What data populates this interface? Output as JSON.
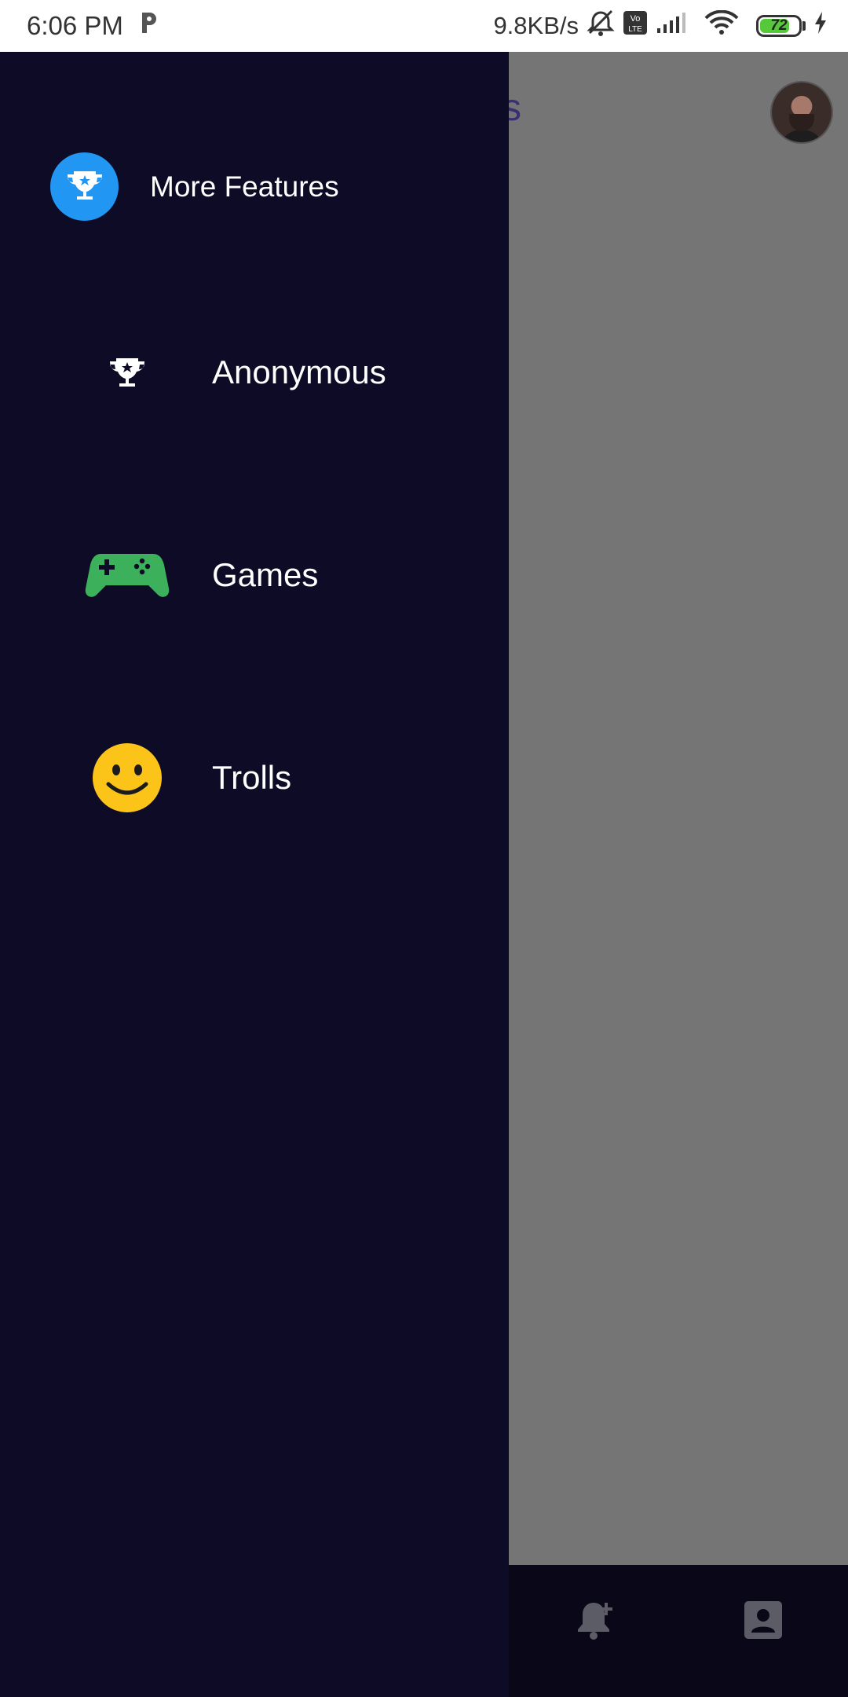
{
  "status_bar": {
    "time": "6:06 PM",
    "network_speed": "9.8KB/s",
    "battery_level": "72",
    "icons": [
      "parking-icon",
      "silent-bell-icon",
      "volte-icon",
      "signal-icon",
      "wifi-icon",
      "battery-icon",
      "charging-icon"
    ]
  },
  "background_app": {
    "title_fragment": "s",
    "bottom_nav_icons": [
      "add-alert-icon",
      "contact-icon"
    ]
  },
  "drawer": {
    "header": {
      "title": "More Features",
      "icon": "trophy-icon"
    },
    "items": [
      {
        "label": "Anonymous",
        "icon": "trophy-icon"
      },
      {
        "label": "Games",
        "icon": "gamepad-icon"
      },
      {
        "label": "Trolls",
        "icon": "smiley-icon"
      }
    ]
  },
  "colors": {
    "drawer_bg": "#0d0b26",
    "header_circle": "#2196f3",
    "scrim": "#757575",
    "games_green": "#3cb05a",
    "smiley_yellow": "#fcc419"
  }
}
